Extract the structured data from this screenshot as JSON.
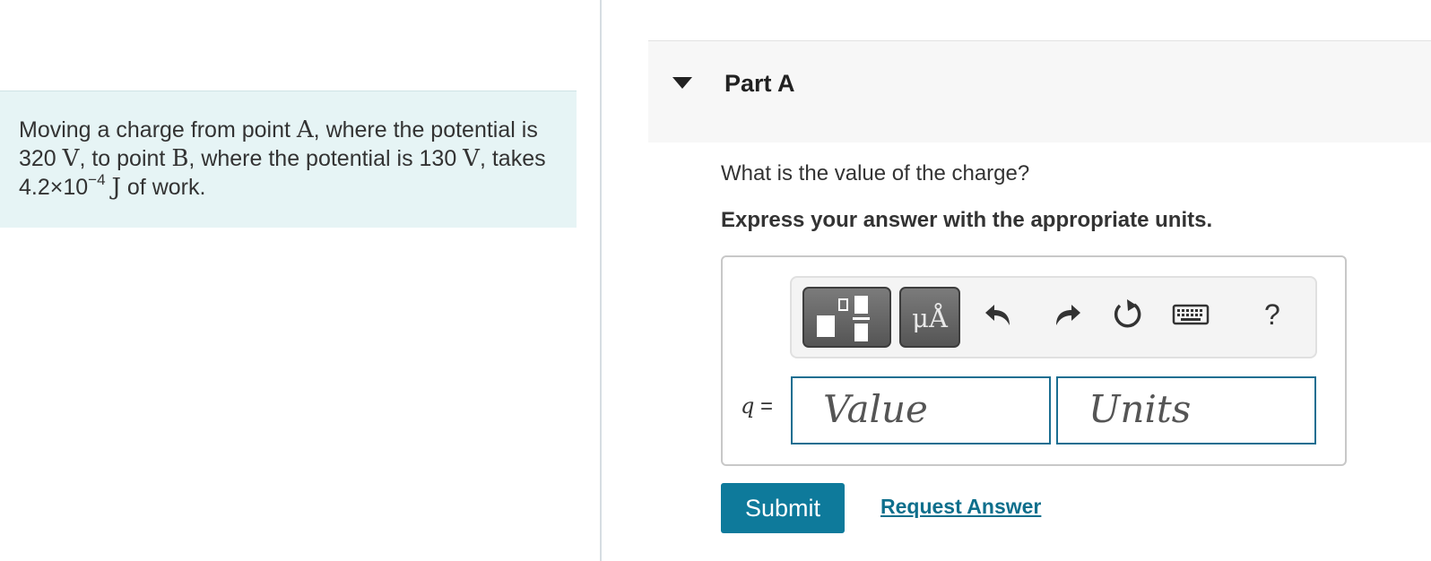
{
  "problem": {
    "t1": "Moving a charge from point ",
    "A": "A",
    "t2": ", where the potential is 320 ",
    "V1": "V",
    "t3": ", to point ",
    "B": "B",
    "t4": ", where the potential is 130 ",
    "V2": "V",
    "t5": ", takes 4.2×10",
    "exp": "−4",
    "t6": " ",
    "J": "J",
    "t7": " of work."
  },
  "part": {
    "title": "Part A"
  },
  "question": "What is the value of the charge?",
  "instruction": "Express your answer with the appropriate units.",
  "toolbar": {
    "units_label": "μÅ",
    "help_label": "?"
  },
  "answer": {
    "variable": "q",
    "equals": " =",
    "value_placeholder": "Value",
    "units_placeholder": "Units"
  },
  "actions": {
    "submit_label": "Submit",
    "request_label": "Request Answer"
  },
  "colors": {
    "accent": "#0e7a9b",
    "problem_bg": "#e6f4f5",
    "field_border": "#1a6e91"
  }
}
